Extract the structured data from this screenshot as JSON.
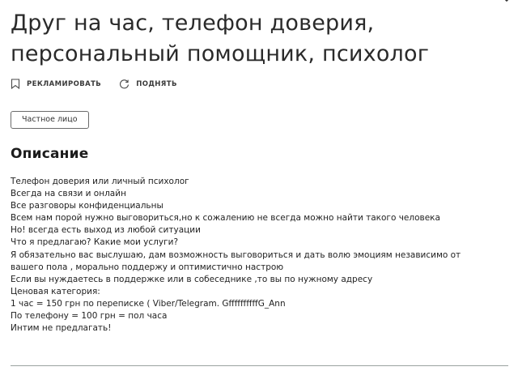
{
  "listing": {
    "title": "Друг на час, телефон доверия, персональный помощник, психолог",
    "actions": {
      "promote_label": "РЕКЛАМИРОВАТЬ",
      "raise_label": "ПОДНЯТЬ"
    },
    "seller_type": "Частное лицо",
    "description_heading": "Описание",
    "description_lines": [
      "Телефон доверия или личный психолог",
      "Всегда на связи и онлайн",
      "Все разговоры конфиденциальны",
      "Всем нам порой нужно выговориться,но к сожалению не всегда можно найти такого человека",
      "Но! всегда есть выход из любой ситуации",
      "Что я предлагаю? Какие мои услуги?",
      "Я обязательно вас выслушаю, дам возможность выговориться и дать волю эмоциям независимо от",
      "вашего пола , морально поддержу и оптимистично настрою",
      "Если вы нуждаетесь в поддержке или в собеседнике ,то вы по нужному адресу",
      "Ценовая категория:",
      "1 час = 150 грн по переписке ( Viber/Telegram. GffffffffffG_Ann",
      "По телефону = 100 грн = пол часа",
      "Интим не предлагать!"
    ]
  },
  "icons": {
    "promote": "bookmark-icon",
    "raise": "refresh-icon",
    "corner": "chevron-icon"
  },
  "colors": {
    "text": "#222222",
    "divider": "#9aa3a0",
    "badge_border": "#6a6a6a"
  }
}
